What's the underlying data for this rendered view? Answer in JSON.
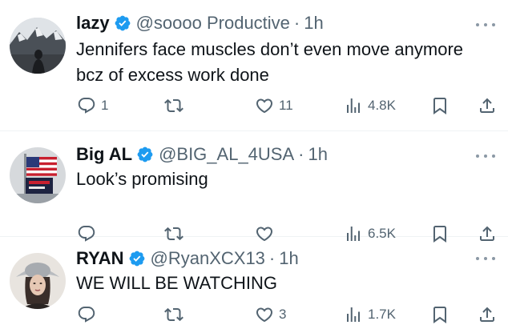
{
  "tweets": [
    {
      "name": "lazy",
      "handle": "@soooo Productive",
      "separator": "·",
      "time": "1h",
      "text": "Jennifers face muscles don’t even move anymore bcz of excess work done",
      "replies": "1",
      "reposts": "",
      "likes": "11",
      "views": "4.8K"
    },
    {
      "name": "Big AL",
      "handle": "@BIG_AL_4USA",
      "separator": "·",
      "time": "1h",
      "text": "Look’s promising",
      "replies": "",
      "reposts": "",
      "likes": "",
      "views": "6.5K"
    },
    {
      "name": "RYAN",
      "handle": "@RyanXCX13",
      "separator": "·",
      "time": "1h",
      "text": "WE WILL BE WATCHING",
      "replies": "",
      "reposts": "",
      "likes": "3",
      "views": "1.7K"
    }
  ],
  "colors": {
    "verified": "#1d9bf0",
    "icon": "#536471",
    "text": "#0f1419",
    "divider": "#eff3f4"
  },
  "icons": [
    "reply-icon",
    "repost-icon",
    "like-icon",
    "views-icon",
    "bookmark-icon",
    "share-icon",
    "more-icon",
    "verified-badge-icon"
  ]
}
